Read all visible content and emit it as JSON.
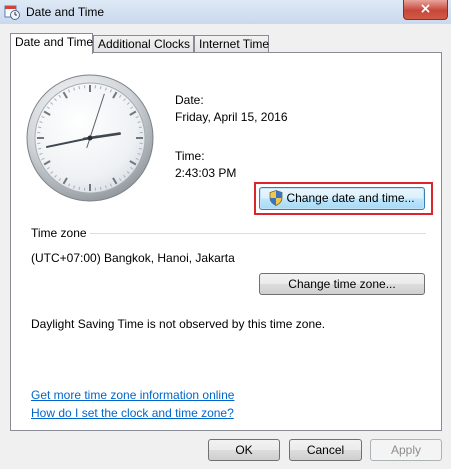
{
  "window": {
    "title": "Date and Time",
    "close_glyph": "×"
  },
  "tabs": [
    {
      "label": "Date and Time",
      "active": true
    },
    {
      "label": "Additional Clocks",
      "active": false
    },
    {
      "label": "Internet Time",
      "active": false
    }
  ],
  "date": {
    "label": "Date:",
    "value": "Friday, April 15, 2016"
  },
  "time": {
    "label": "Time:",
    "value": "2:43:03 PM"
  },
  "clock": {
    "hours": 2,
    "minutes": 43,
    "seconds": 3
  },
  "change_datetime_button": "Change date and time...",
  "timezone": {
    "section_label": "Time zone",
    "value": "(UTC+07:00) Bangkok, Hanoi, Jakarta",
    "change_button": "Change time zone...",
    "dst_note": "Daylight Saving Time is not observed by this time zone."
  },
  "links": {
    "more_info": "Get more time zone information online",
    "how_to": "How do I set the clock and time zone?"
  },
  "footer": {
    "ok": "OK",
    "cancel": "Cancel",
    "apply": "Apply"
  },
  "colors": {
    "highlight_border": "#d9262c",
    "link": "#0066cc"
  },
  "icons": {
    "title": "date-time-icon",
    "uac": "uac-shield-icon"
  }
}
